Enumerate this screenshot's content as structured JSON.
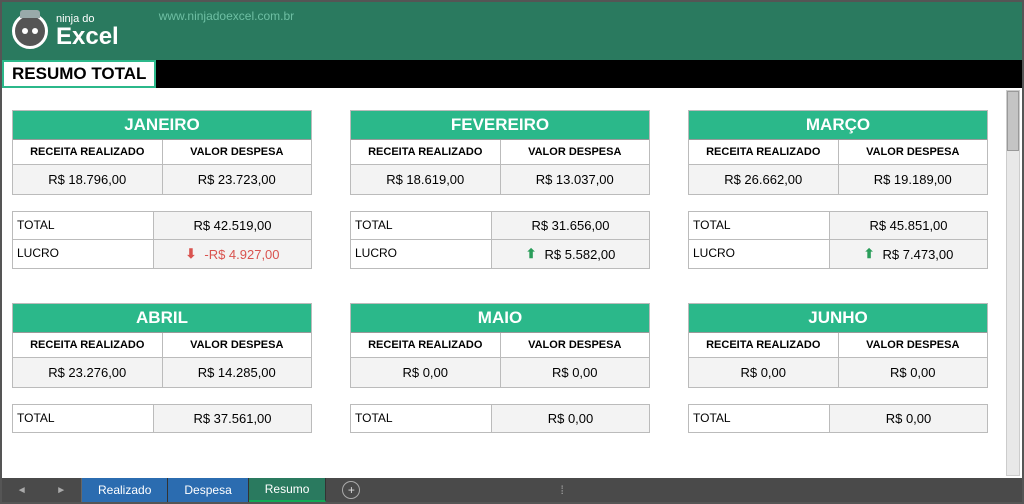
{
  "brand": {
    "top": "ninja do",
    "bottom": "Excel",
    "url": "www.ninjadoexcel.com.br"
  },
  "title": "RESUMO TOTAL",
  "labels": {
    "receita": "RECEITA REALIZADO",
    "despesa": "VALOR DESPESA",
    "total": "TOTAL",
    "lucro": "LUCRO"
  },
  "months": [
    {
      "name": "JANEIRO",
      "receita": "R$ 18.796,00",
      "despesa": "R$ 23.723,00",
      "total": "R$ 42.519,00",
      "lucro": "-R$ 4.927,00",
      "dir": "down"
    },
    {
      "name": "FEVEREIRO",
      "receita": "R$ 18.619,00",
      "despesa": "R$ 13.037,00",
      "total": "R$ 31.656,00",
      "lucro": "R$ 5.582,00",
      "dir": "up"
    },
    {
      "name": "MARÇO",
      "receita": "R$ 26.662,00",
      "despesa": "R$ 19.189,00",
      "total": "R$ 45.851,00",
      "lucro": "R$ 7.473,00",
      "dir": "up"
    },
    {
      "name": "ABRIL",
      "receita": "R$ 23.276,00",
      "despesa": "R$ 14.285,00",
      "total": "R$ 37.561,00",
      "lucro": "",
      "dir": ""
    },
    {
      "name": "MAIO",
      "receita": "R$ 0,00",
      "despesa": "R$ 0,00",
      "total": "R$ 0,00",
      "lucro": "",
      "dir": ""
    },
    {
      "name": "JUNHO",
      "receita": "R$ 0,00",
      "despesa": "R$ 0,00",
      "total": "R$ 0,00",
      "lucro": "",
      "dir": ""
    }
  ],
  "tabs": [
    "Realizado",
    "Despesa",
    "Resumo"
  ]
}
